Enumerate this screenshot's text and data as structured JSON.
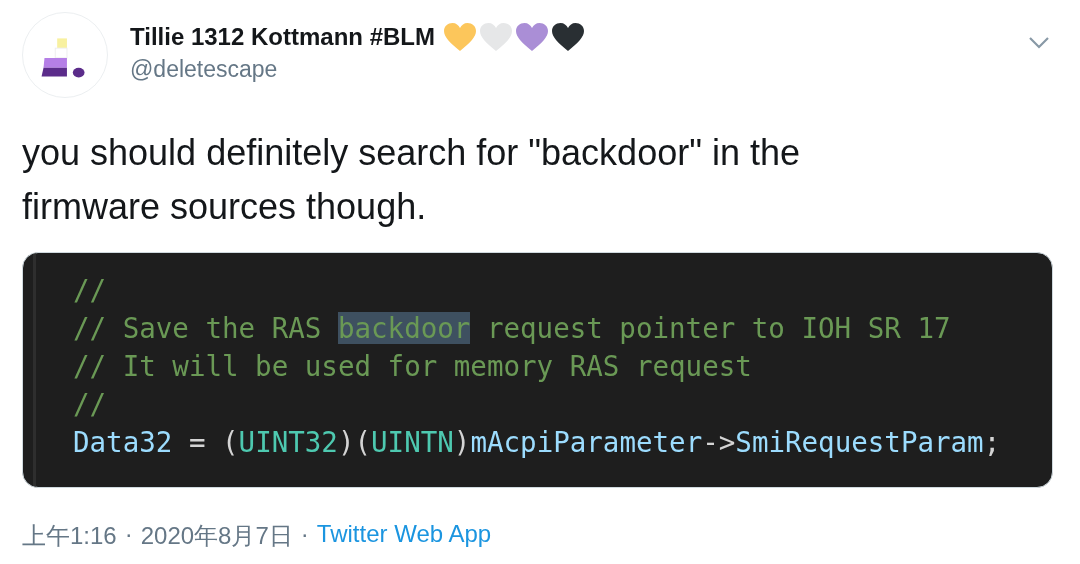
{
  "author": {
    "name": "Tillie 1312 Kottmann #BLM",
    "hearts": [
      {
        "color": "#fcc65b"
      },
      {
        "color": "#e6e7e8"
      },
      {
        "color": "#aa8ed6"
      },
      {
        "color": "#292f33"
      }
    ],
    "handle": "@deletescape"
  },
  "tweet_text": [
    "you should definitely search for \"backdoor\" in the",
    "firmware sources though."
  ],
  "code_lines": [
    [
      {
        "kind": "comment",
        "text": "//"
      }
    ],
    [
      {
        "kind": "comment",
        "text": "// Save the RAS "
      },
      {
        "kind": "highlight",
        "text": "backdoor"
      },
      {
        "kind": "comment",
        "text": " request pointer to IOH SR 17"
      }
    ],
    [
      {
        "kind": "comment",
        "text": "// It will be used for memory RAS request"
      }
    ],
    [
      {
        "kind": "comment",
        "text": "//"
      }
    ],
    [
      {
        "kind": "ident",
        "text": "Data32"
      },
      {
        "kind": "plain",
        "text": " = ("
      },
      {
        "kind": "type",
        "text": "UINT32"
      },
      {
        "kind": "plain",
        "text": ")("
      },
      {
        "kind": "type",
        "text": "UINTN"
      },
      {
        "kind": "plain",
        "text": ")"
      },
      {
        "kind": "ident",
        "text": "mAcpiParameter"
      },
      {
        "kind": "plain",
        "text": "->"
      },
      {
        "kind": "ident",
        "text": "SmiRequestParam"
      },
      {
        "kind": "plain",
        "text": ";"
      }
    ]
  ],
  "meta": {
    "time": "上午1:16",
    "separator_1": "·",
    "date": "2020年8月7日",
    "separator_2": "·",
    "source": "Twitter Web App"
  }
}
